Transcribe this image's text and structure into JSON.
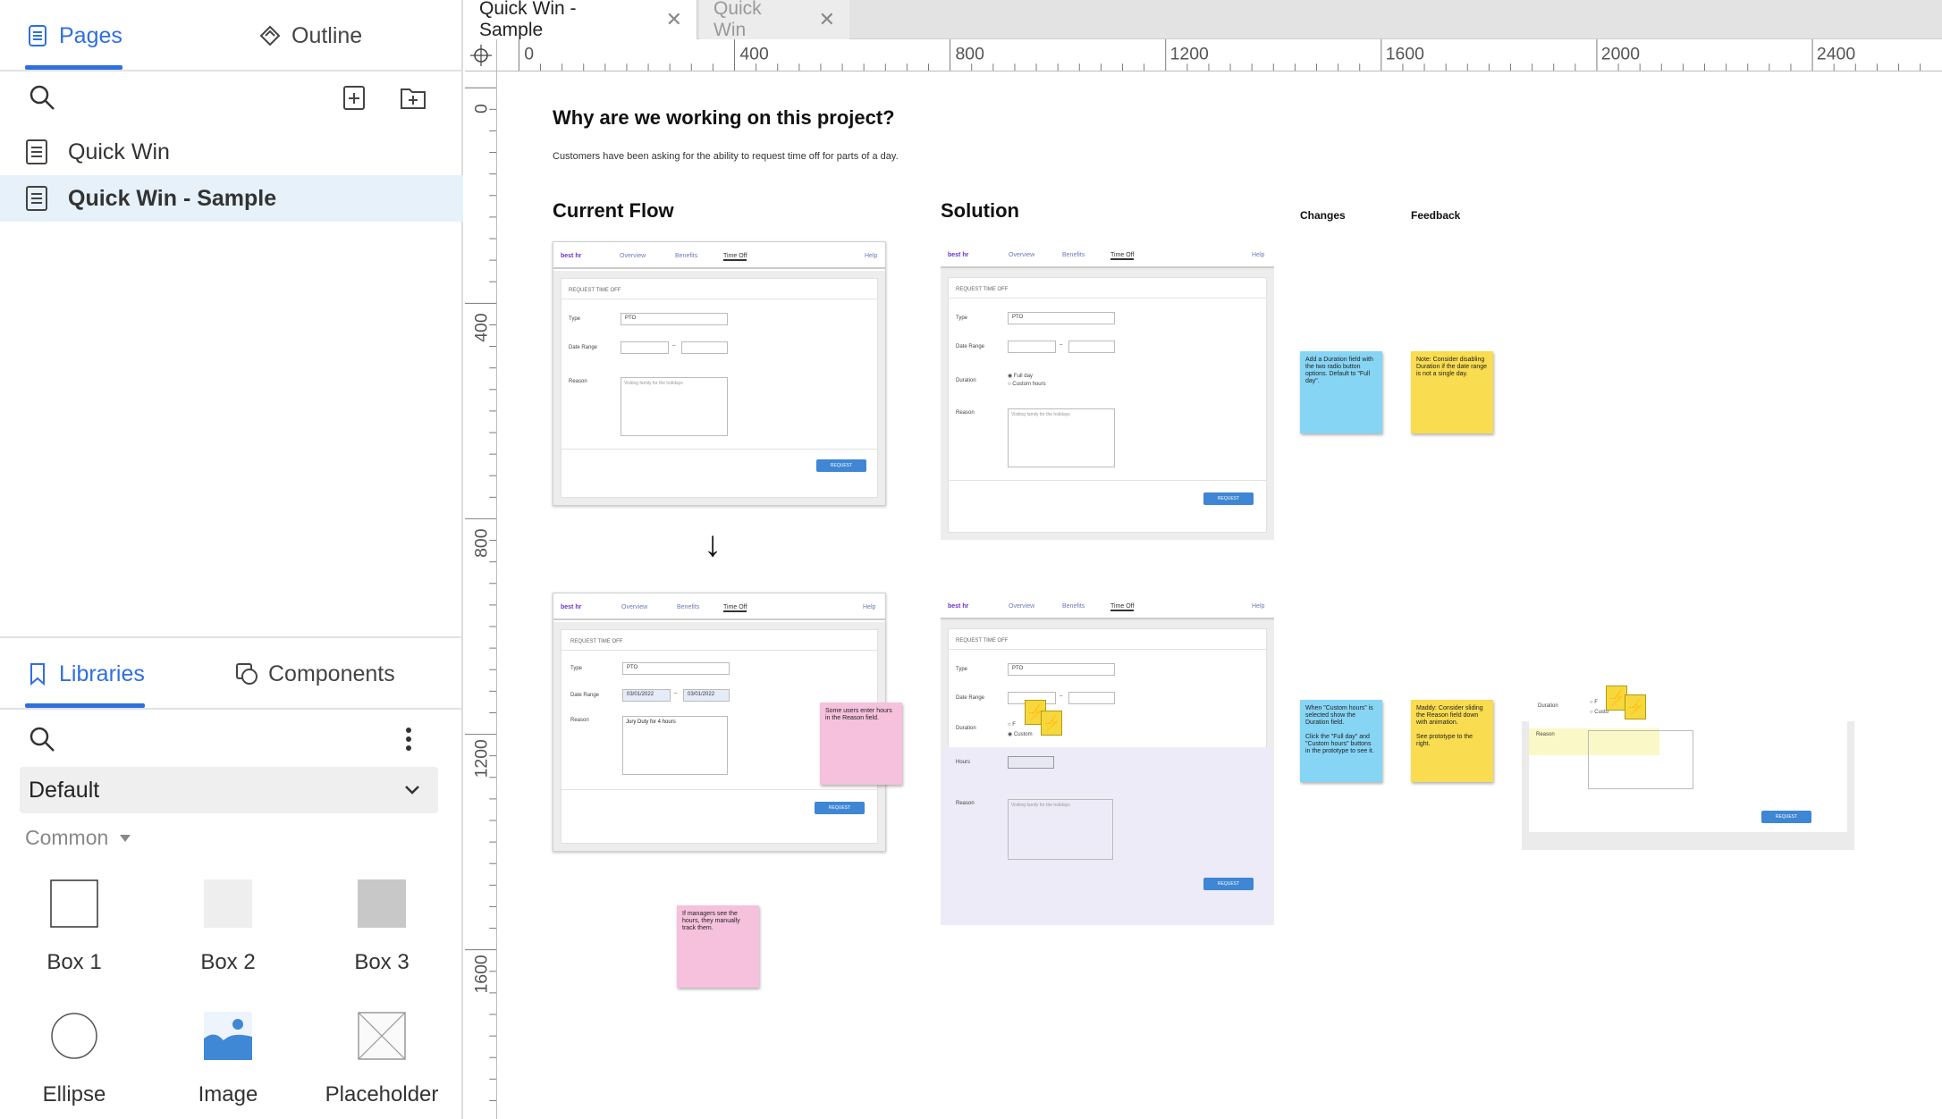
{
  "sidebar": {
    "tabs": [
      {
        "label": "Pages",
        "icon": "page-icon",
        "active": true
      },
      {
        "label": "Outline",
        "icon": "outline-icon",
        "active": false
      }
    ],
    "pages": [
      {
        "label": "Quick Win",
        "selected": false
      },
      {
        "label": "Quick Win - Sample",
        "selected": true
      }
    ],
    "library_tabs": [
      {
        "label": "Libraries",
        "icon": "bookmark-icon",
        "active": true
      },
      {
        "label": "Components",
        "icon": "components-icon",
        "active": false
      }
    ],
    "library_select": "Default",
    "section": "Common",
    "library_items": [
      {
        "label": "Box 1",
        "icon": "box-outline-icon"
      },
      {
        "label": "Box 2",
        "icon": "box-light-icon"
      },
      {
        "label": "Box 3",
        "icon": "box-gray-icon"
      },
      {
        "label": "Ellipse",
        "icon": "ellipse-icon"
      },
      {
        "label": "Image",
        "icon": "image-icon"
      },
      {
        "label": "Placeholder",
        "icon": "placeholder-icon"
      }
    ]
  },
  "doc_tabs": [
    {
      "label": "Quick Win - Sample",
      "active": true
    },
    {
      "label": "Quick Win",
      "active": false
    }
  ],
  "ruler": {
    "h": [
      "0",
      "400",
      "800",
      "1200",
      "1600",
      "2000",
      "2400"
    ],
    "v": [
      "0",
      "400",
      "800",
      "1200",
      "1600"
    ]
  },
  "canvas": {
    "title": "Why are we working on this project?",
    "subtitle": "Customers have been asking for the ability to request time off for parts of a day.",
    "current_flow": "Current Flow",
    "solution": "Solution",
    "changes": "Changes",
    "feedback": "Feedback",
    "arrow": "↓",
    "mock": {
      "logo": "best hr",
      "nav": [
        "Overview",
        "Benefits",
        "Time Off",
        "Help"
      ],
      "heading": "REQUEST TIME OFF",
      "type_label": "Type",
      "type_value": "PTO",
      "date_label": "Date Range",
      "date_from": "03/01/2022",
      "date_to": "03/01/2022",
      "duration_label": "Duration",
      "full_day": "Full day",
      "custom_hours": "Custom hours",
      "hours_label": "Hours",
      "reason_label": "Reason",
      "reason_placeholder": "Visiting family for the holidays",
      "reason_value": "Jury Duty for 4 hours",
      "request_btn": "REQUEST",
      "dash": "–"
    },
    "stickies": {
      "changes_1": "Add a Duration field with the two radio button options. Default to \"Full day\".",
      "feedback_1": "Note: Consider disabling Duration if the date range is not a single day.",
      "flow_note": "Some users enter hours in the Reason field.",
      "manager_note": "If managers see the hours, they manually track them.",
      "changes_2a": "When \"Custom hours\" is selected show the Duration field.",
      "changes_2b": "Click the \"Full day\" and \"Custom hours\" buttons in the prototype to see it.",
      "feedback_2a": "Maddy: Consider sliding the Reason field down with animation.",
      "feedback_2b": "See prototype to the right."
    },
    "prototype": {
      "duration_label": "Duration",
      "full_prefix": "F",
      "custom_prefix": "Custo",
      "reason_label": "Reason"
    }
  },
  "colors": {
    "accent": "#2f6fe0",
    "selected_page_bg": "#e6f1fa",
    "sticky_blue": "#86d5f5",
    "sticky_yellow": "#f9dc4f",
    "sticky_pink": "#f5c1dc",
    "button_blue": "#3f86d4"
  }
}
